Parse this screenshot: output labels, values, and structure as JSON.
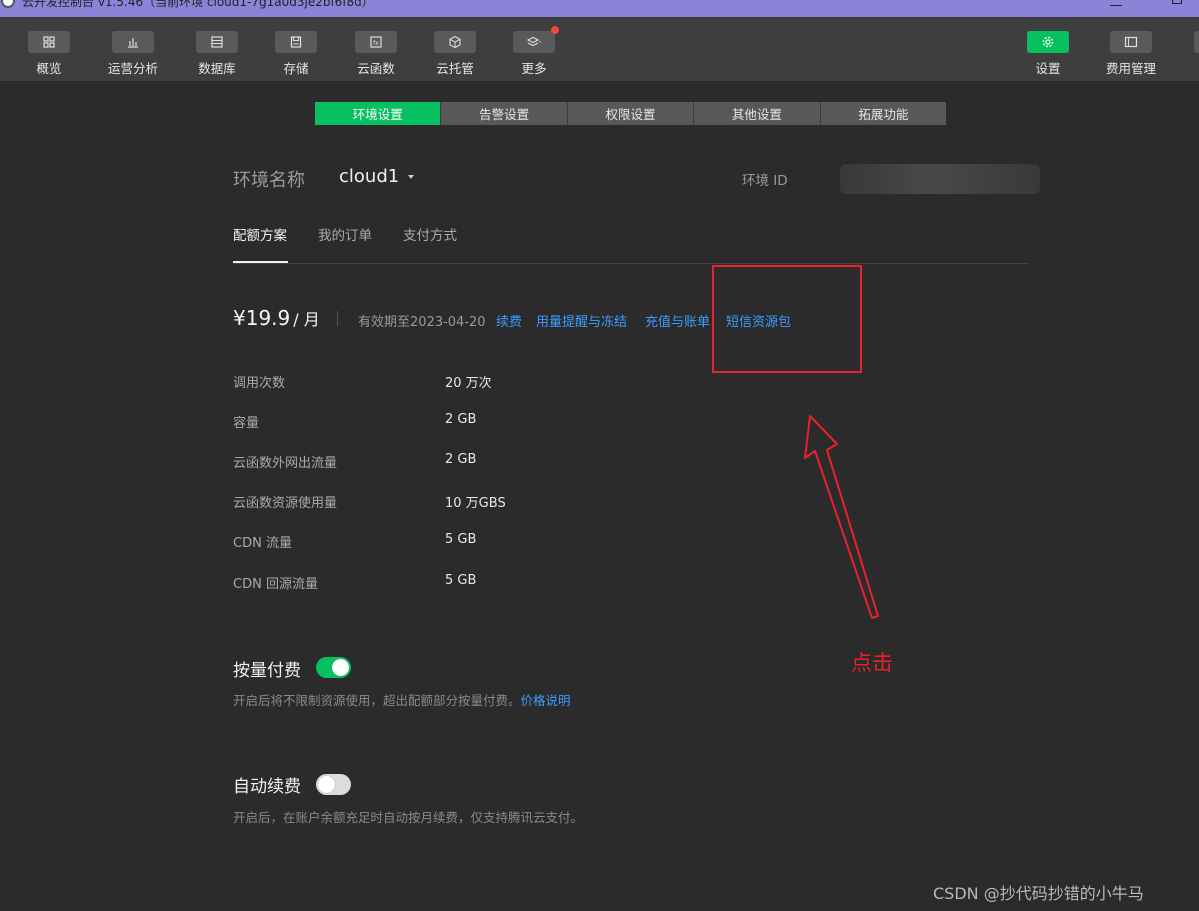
{
  "window": {
    "title": "云开发控制台 v1.5.46（当前环境 cloud1-7g1a0d3je2bf6f8d）"
  },
  "toolbar": {
    "left": [
      {
        "label": "概览",
        "icon": "grid-icon"
      },
      {
        "label": "运营分析",
        "icon": "bar-chart-icon"
      },
      {
        "label": "数据库",
        "icon": "database-icon"
      },
      {
        "label": "存储",
        "icon": "storage-icon"
      },
      {
        "label": "云函数",
        "icon": "function-icon"
      },
      {
        "label": "云托管",
        "icon": "cube-icon"
      },
      {
        "label": "更多",
        "icon": "layers-icon"
      }
    ],
    "right": [
      {
        "label": "设置",
        "icon": "gear-icon"
      },
      {
        "label": "费用管理",
        "icon": "billing-icon"
      }
    ]
  },
  "tabs": [
    "环境设置",
    "告警设置",
    "权限设置",
    "其他设置",
    "拓展功能"
  ],
  "env": {
    "label": "环境名称",
    "value": "cloud1",
    "id_label": "环境 ID"
  },
  "subtabs": [
    "配额方案",
    "我的订单",
    "支付方式"
  ],
  "plan": {
    "price": "¥19.9",
    "unit": "/ 月",
    "valid_until": "有效期至2023-04-20",
    "links": [
      "续费",
      "用量提醒与冻结",
      "充值与账单",
      "短信资源包"
    ]
  },
  "quota": [
    {
      "key": "调用次数",
      "value": "20 万次"
    },
    {
      "key": "容量",
      "value": "2 GB"
    },
    {
      "key": "云函数外网出流量",
      "value": "2 GB"
    },
    {
      "key": "云函数资源使用量",
      "value": "10 万GBS"
    },
    {
      "key": "CDN 流量",
      "value": "5 GB"
    },
    {
      "key": "CDN 回源流量",
      "value": "5 GB"
    }
  ],
  "pay_as_you_go": {
    "title": "按量付费",
    "enabled": true,
    "desc": "开启后将不限制资源使用，超出配额部分按量付费。",
    "link": "价格说明"
  },
  "auto_renew": {
    "title": "自动续费",
    "enabled": false,
    "desc": "开启后，在账户余额充足时自动按月续费，仅支持腾讯云支付。"
  },
  "annotation": {
    "text": "点击",
    "color": "#e8212b"
  },
  "watermark": "CSDN @抄代码抄错的小牛马",
  "colors": {
    "accent": "#07c160",
    "link": "#3a9dff",
    "background": "#2b2b2b"
  }
}
